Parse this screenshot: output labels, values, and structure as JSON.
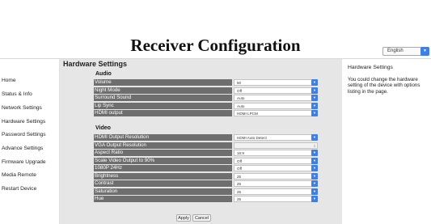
{
  "header": {
    "title": "Receiver Configuration",
    "language": {
      "selected": "English"
    }
  },
  "sidebar": {
    "items": [
      {
        "label": "Home"
      },
      {
        "label": "Status & Info"
      },
      {
        "label": "Network Settings"
      },
      {
        "label": "Hardware Settings"
      },
      {
        "label": "Password Settings"
      },
      {
        "label": "Advance Settings"
      },
      {
        "label": "Firmware Upgrade"
      },
      {
        "label": "Media Remote"
      },
      {
        "label": "Restart Device"
      }
    ]
  },
  "main": {
    "title": "Hardware Settings",
    "groups": [
      {
        "label": "Audio",
        "rows": [
          {
            "label": "Volume",
            "value": "50"
          },
          {
            "label": "Night Mode",
            "value": "Off"
          },
          {
            "label": "Surround Sound",
            "value": "Auto"
          },
          {
            "label": "Lip Sync",
            "value": "Auto"
          },
          {
            "label": "HDMI output",
            "value": "HDMI LPCM"
          }
        ]
      },
      {
        "label": "Video",
        "rows": [
          {
            "label": "HDMI Output Resolution",
            "value": "HDMI Auto Detect"
          },
          {
            "label": "VGA Output Resolution",
            "value": ""
          },
          {
            "label": "Aspect Ratio",
            "value": "16:9"
          },
          {
            "label": "Scale Video Output to 90%",
            "value": "Off"
          },
          {
            "label": "1080P 24Hz",
            "value": "Off"
          },
          {
            "label": "Brightness",
            "value": "25"
          },
          {
            "label": "Contrast",
            "value": "25"
          },
          {
            "label": "Saturation",
            "value": "25"
          },
          {
            "label": "Hue",
            "value": "25"
          }
        ]
      }
    ],
    "apply_label": "Apply",
    "cancel_label": "Cancel"
  },
  "help": {
    "title": "Hardware Settings",
    "text": "You could change the hardware setting of the device with options listing in the page."
  }
}
